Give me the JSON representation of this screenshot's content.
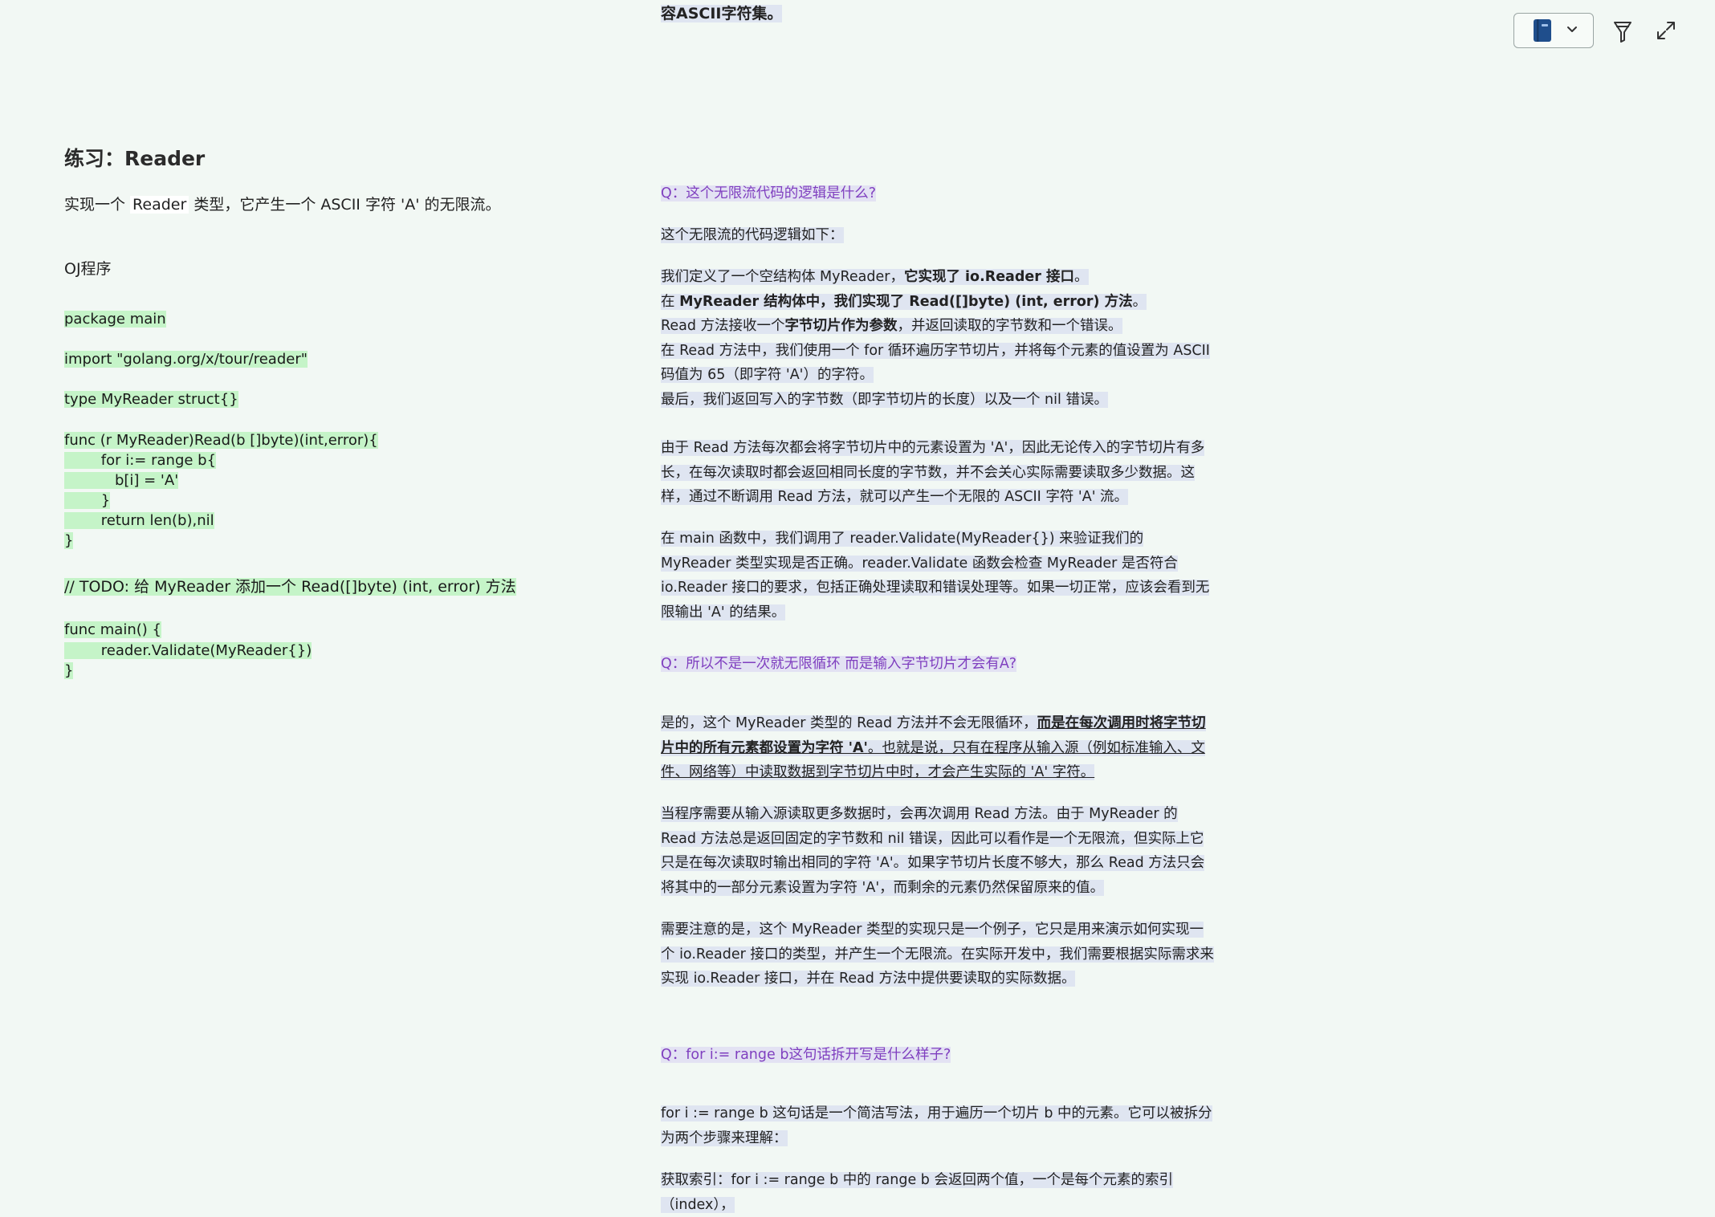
{
  "left": {
    "title": "练习：Reader",
    "intro_pre": "实现一个 ",
    "intro_code": "Reader",
    "intro_post": " 类型，它产生一个 ASCII 字符 'A' 的无限流。",
    "oj_label": "OJ程序",
    "code_lines": [
      "package main",
      "import \"golang.org/x/tour/reader\"",
      "type MyReader struct{}",
      "func (r MyReader)Read(b []byte)(int,error){",
      "        for i:= range b{",
      "           b[i] = 'A'",
      "        }",
      "        return len(b),nil",
      "}",
      "// TODO: 给 MyReader 添加一个 Read([]byte) (int, error) 方法",
      "func main() {",
      "        reader.Validate(MyReader{})",
      "}"
    ]
  },
  "right": {
    "top_fragment": "容ASCII字符集。",
    "q1": "Q：这个无限流代码的逻辑是什么?",
    "a1_intro": "这个无限流的代码逻辑如下：",
    "a1_l1_pre": "我们定义了一个空结构体 MyReader，",
    "a1_l1_bold": "它实现了 io.Reader 接口",
    "a1_l1_post": "。",
    "a1_l2_pre": "在 ",
    "a1_l2_bold": "MyReader 结构体中，我们实现了 Read([]byte) (int, error) 方法",
    "a1_l2_post": "。",
    "a1_l3_pre": "Read 方法接收一个",
    "a1_l3_bold": "字节切片作为参数",
    "a1_l3_post": "，并返回读取的字节数和一个错误。",
    "a1_l4": "在 Read 方法中，我们使用一个 for 循环遍历字节切片，并将每个元素的值设置为 ASCII 码值为 65（即字符 'A'）的字符。",
    "a1_l5": "最后，我们返回写入的字节数（即字节切片的长度）以及一个 nil 错误。",
    "a1_p2": "由于 Read 方法每次都会将字节切片中的元素设置为 'A'，因此无论传入的字节切片有多长，在每次读取时都会返回相同长度的字节数，并不会关心实际需要读取多少数据。这样，通过不断调用 Read 方法，就可以产生一个无限的 ASCII 字符 'A' 流。",
    "a1_p3": "在 main 函数中，我们调用了 reader.Validate(MyReader{}) 来验证我们的 MyReader 类型实现是否正确。reader.Validate 函数会检查 MyReader 是否符合 io.Reader 接口的要求，包括正确处理读取和错误处理等。如果一切正常，应该会看到无限输出 'A' 的结果。",
    "q2": "Q：所以不是一次就无限循环 而是输入字节切片才会有A?",
    "a2_p1_pre": "是的，这个 MyReader 类型的 Read 方法并不会无限循环，",
    "a2_p1_bold": "而是在每次调用时将字节切片中的所有元素都设置为字符 'A'",
    "a2_p1_post": "。也就是说，只有在程序从输入源（例如标准输入、文件、网络等）中读取数据到字节切片中时，才会产生实际的 'A' 字符。",
    "a2_p2": "当程序需要从输入源读取更多数据时，会再次调用 Read 方法。由于 MyReader 的 Read 方法总是返回固定的字节数和 nil 错误，因此可以看作是一个无限流，但实际上它只是在每次读取时输出相同的字符 'A'。如果字节切片长度不够大，那么 Read 方法只会将其中的一部分元素设置为字符 'A'，而剩余的元素仍然保留原来的值。",
    "a2_p3": "需要注意的是，这个 MyReader 类型的实现只是一个例子，它只是用来演示如何实现一个 io.Reader 接口的类型，并产生一个无限流。在实际开发中，我们需要根据实际需求来实现 io.Reader 接口，并在 Read 方法中提供要读取的实际数据。",
    "q3": "Q：for i:= range b这句话拆开写是什么样子?",
    "a3_p1": "for i := range b 这句话是一个简洁写法，用于遍历一个切片 b 中的元素。它可以被拆分为两个步骤来理解：",
    "a3_p2": "获取索引：for i := range b 中的 range b 会返回两个值，一个是每个元素的索引（index），"
  },
  "toolbar": {
    "notebook_icon": "notebook-icon",
    "chevron_icon": "chevron-down-icon",
    "pen_icon": "highlighter-icon",
    "expand_icon": "expand-icon"
  }
}
